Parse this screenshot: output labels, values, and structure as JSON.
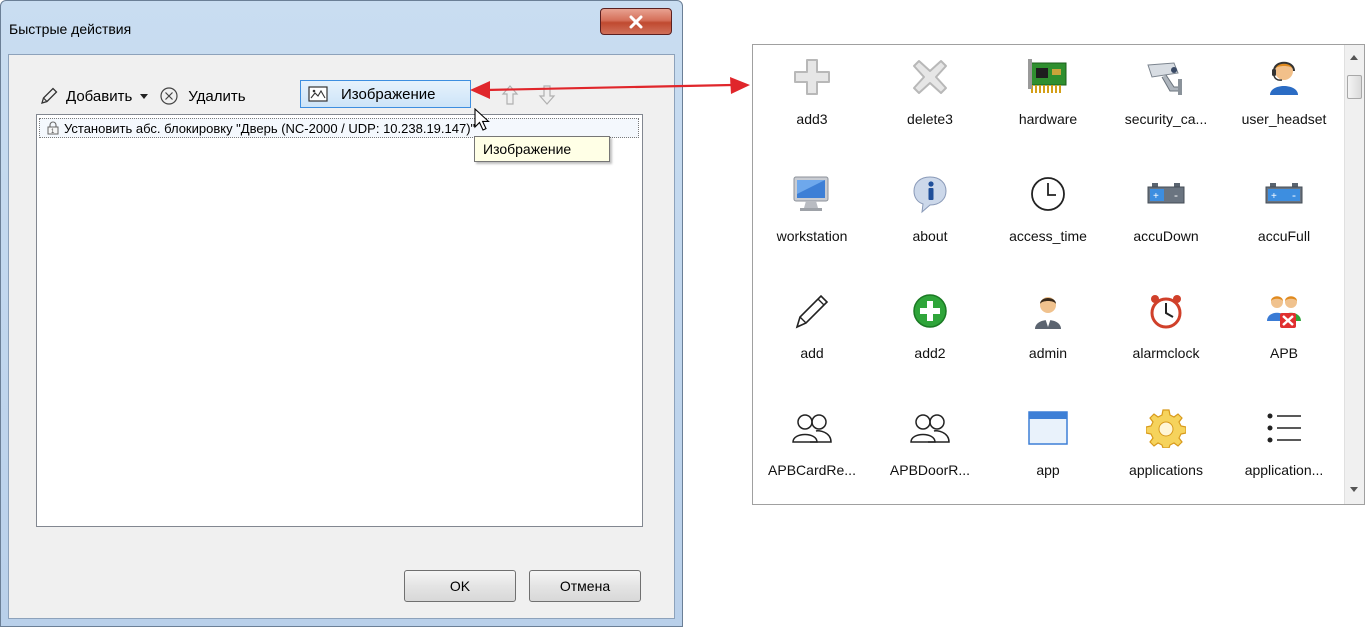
{
  "dialog": {
    "title": "Быстрые действия",
    "toolbar": {
      "add_label": "Добавить",
      "delete_label": "Удалить",
      "image_label": "Изображение"
    },
    "list_items": [
      {
        "label": "Установить абс. блокировку \"Дверь (NC-2000 / UDP: 10.238.19.147)\""
      }
    ],
    "tooltip": "Изображение",
    "ok_label": "OK",
    "cancel_label": "Отмена"
  },
  "picker": {
    "items": [
      {
        "label": "add3",
        "icon": "add3-icon"
      },
      {
        "label": "delete3",
        "icon": "delete3-icon"
      },
      {
        "label": "hardware",
        "icon": "hardware-icon"
      },
      {
        "label": "security_ca...",
        "icon": "security-camera-icon"
      },
      {
        "label": "user_headset",
        "icon": "user-headset-icon"
      },
      {
        "label": "workstation",
        "icon": "workstation-icon"
      },
      {
        "label": "about",
        "icon": "about-icon"
      },
      {
        "label": "access_time",
        "icon": "access-time-icon"
      },
      {
        "label": "accuDown",
        "icon": "accu-down-icon"
      },
      {
        "label": "accuFull",
        "icon": "accu-full-icon"
      },
      {
        "label": "add",
        "icon": "pencil-icon"
      },
      {
        "label": "add2",
        "icon": "add2-icon"
      },
      {
        "label": "admin",
        "icon": "admin-icon"
      },
      {
        "label": "alarmclock",
        "icon": "alarm-clock-icon"
      },
      {
        "label": "APB",
        "icon": "apb-icon"
      },
      {
        "label": "APBCardRe...",
        "icon": "apb-card-icon"
      },
      {
        "label": "APBDoorR...",
        "icon": "apb-door-icon"
      },
      {
        "label": "app",
        "icon": "app-icon"
      },
      {
        "label": "applications",
        "icon": "applications-icon"
      },
      {
        "label": "application...",
        "icon": "application-list-icon"
      }
    ]
  },
  "colors": {
    "accent_arrow": "#e0262b",
    "selection_border": "#3d8ee0"
  }
}
